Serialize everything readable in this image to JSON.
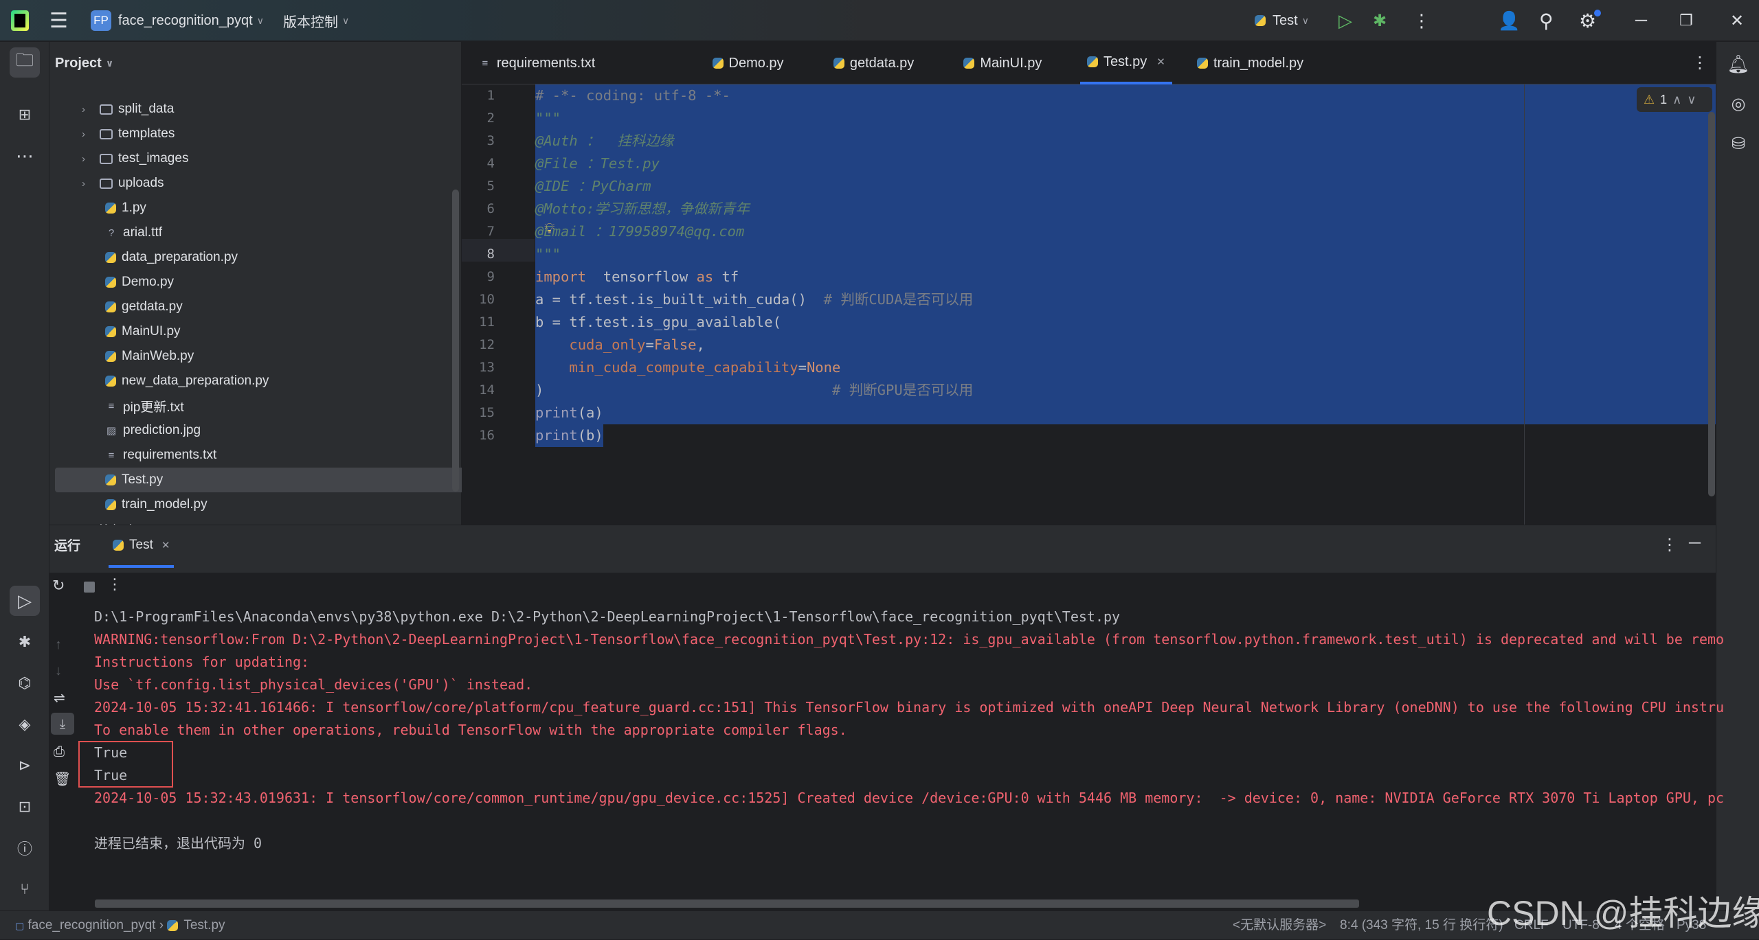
{
  "titlebar": {
    "project_badge": "FP",
    "project_name": "face_recognition_pyqt",
    "vcs": "版本控制",
    "run_config": "Test"
  },
  "project_panel": {
    "title": "Project",
    "items": [
      {
        "label": "split_data",
        "type": "folder",
        "depth": 1,
        "expandable": true
      },
      {
        "label": "templates",
        "type": "folder",
        "depth": 1,
        "expandable": true
      },
      {
        "label": "test_images",
        "type": "folder",
        "depth": 1,
        "expandable": true
      },
      {
        "label": "uploads",
        "type": "folder",
        "depth": 1,
        "expandable": true
      },
      {
        "label": "1.py",
        "type": "py",
        "depth": 1
      },
      {
        "label": "arial.ttf",
        "type": "font",
        "depth": 1
      },
      {
        "label": "data_preparation.py",
        "type": "py",
        "depth": 1
      },
      {
        "label": "Demo.py",
        "type": "py",
        "depth": 1
      },
      {
        "label": "getdata.py",
        "type": "py",
        "depth": 1
      },
      {
        "label": "MainUI.py",
        "type": "py",
        "depth": 1
      },
      {
        "label": "MainWeb.py",
        "type": "py",
        "depth": 1
      },
      {
        "label": "new_data_preparation.py",
        "type": "py",
        "depth": 1
      },
      {
        "label": "pip更新.txt",
        "type": "txt",
        "depth": 1
      },
      {
        "label": "prediction.jpg",
        "type": "img",
        "depth": 1
      },
      {
        "label": "requirements.txt",
        "type": "txt",
        "depth": 1
      },
      {
        "label": "Test.py",
        "type": "py",
        "depth": 1,
        "selected": true
      },
      {
        "label": "train_model.py",
        "type": "py",
        "depth": 1
      },
      {
        "label": "外部库",
        "type": "lib",
        "depth": 0,
        "expandable": true
      }
    ]
  },
  "tabs": [
    {
      "label": "requirements.txt",
      "type": "txt"
    },
    {
      "label": "Demo.py",
      "type": "py"
    },
    {
      "label": "getdata.py",
      "type": "py"
    },
    {
      "label": "MainUI.py",
      "type": "py"
    },
    {
      "label": "Test.py",
      "type": "py",
      "active": true
    },
    {
      "label": "train_model.py",
      "type": "py"
    }
  ],
  "editor": {
    "warnings": "1",
    "current_line": 8,
    "lines": [
      [
        [
          "cmt",
          "# -*- coding: utf-8 -*-"
        ]
      ],
      [
        [
          "doc",
          "\"\"\""
        ]
      ],
      [
        [
          "doc",
          "@Auth ：  挂科边缘"
        ]
      ],
      [
        [
          "doc",
          "@File ：Test.py"
        ]
      ],
      [
        [
          "doc",
          "@IDE ：PyCharm"
        ]
      ],
      [
        [
          "doc",
          "@Motto:学习新思想，争做新青年"
        ]
      ],
      [
        [
          "doc",
          "@Email ：179958974@qq.com"
        ]
      ],
      [
        [
          "doc",
          "\"\"\""
        ]
      ],
      [
        [
          "kw",
          "import"
        ],
        [
          "",
          "  tensorflow "
        ],
        [
          "kw",
          "as"
        ],
        [
          "",
          " tf"
        ]
      ],
      [
        [
          "",
          "a = tf.test.is_built_with_cuda()  "
        ],
        [
          "cmt",
          "# 判断CUDA是否可以用"
        ]
      ],
      [
        [
          "",
          "b = tf.test.is_gpu_available("
        ]
      ],
      [
        [
          "",
          "    "
        ],
        [
          "par",
          "cuda_only"
        ],
        [
          "",
          "="
        ],
        [
          "kw",
          "False"
        ],
        [
          "",
          ","
        ]
      ],
      [
        [
          "",
          "    "
        ],
        [
          "par",
          "min_cuda_compute_capability"
        ],
        [
          "",
          "="
        ],
        [
          "kw",
          "None"
        ]
      ],
      [
        [
          "",
          ")                                  "
        ],
        [
          "cmt",
          "# 判断GPU是否可以用"
        ]
      ],
      [
        [
          "fn",
          "print"
        ],
        [
          "",
          "(a)"
        ]
      ],
      [
        [
          "fn",
          "print"
        ],
        [
          "",
          "(b)"
        ]
      ]
    ]
  },
  "run_panel": {
    "title": "运行",
    "tab": "Test",
    "lines": [
      {
        "text": "D:\\1-ProgramFiles\\Anaconda\\envs\\py38\\python.exe D:\\2-Python\\2-DeepLearningProject\\1-Tensorflow\\face_recognition_pyqt\\Test.py",
        "kind": "normal"
      },
      {
        "text": "WARNING:tensorflow:From D:\\2-Python\\2-DeepLearningProject\\1-Tensorflow\\face_recognition_pyqt\\Test.py:12: is_gpu_available (from tensorflow.python.framework.test_util) is deprecated and will be remo",
        "kind": "err"
      },
      {
        "text": "Instructions for updating:",
        "kind": "err"
      },
      {
        "text": "Use `tf.config.list_physical_devices('GPU')` instead.",
        "kind": "err"
      },
      {
        "text": "2024-10-05 15:32:41.161466: I tensorflow/core/platform/cpu_feature_guard.cc:151] This TensorFlow binary is optimized with oneAPI Deep Neural Network Library (oneDNN) to use the following CPU instru",
        "kind": "err"
      },
      {
        "text": "To enable them in other operations, rebuild TensorFlow with the appropriate compiler flags.",
        "kind": "err"
      },
      {
        "text": "True",
        "kind": "normal"
      },
      {
        "text": "True",
        "kind": "normal"
      },
      {
        "text": "2024-10-05 15:32:43.019631: I tensorflow/core/common_runtime/gpu/gpu_device.cc:1525] Created device /device:GPU:0 with 5446 MB memory:  -> device: 0, name: NVIDIA GeForce RTX 3070 Ti Laptop GPU, pc",
        "kind": "err"
      },
      {
        "text": "",
        "kind": "normal"
      },
      {
        "text": "进程已结束，退出代码为 0",
        "kind": "normal"
      }
    ]
  },
  "status": {
    "breadcrumb_project": "face_recognition_pyqt",
    "breadcrumb_file": "Test.py",
    "server": "<无默认服务器>",
    "position": "8:4 (343 字符, 15 行 换行符)",
    "line_sep": "CRLF",
    "encoding": "UTF-8",
    "indent": "4 个空格",
    "python": "Py38"
  },
  "watermark": "CSDN @挂科边缘",
  "colors": {
    "accent": "#3574f0",
    "selection": "#214283",
    "error_text": "#f0626f",
    "highlight_box": "#e05050"
  }
}
